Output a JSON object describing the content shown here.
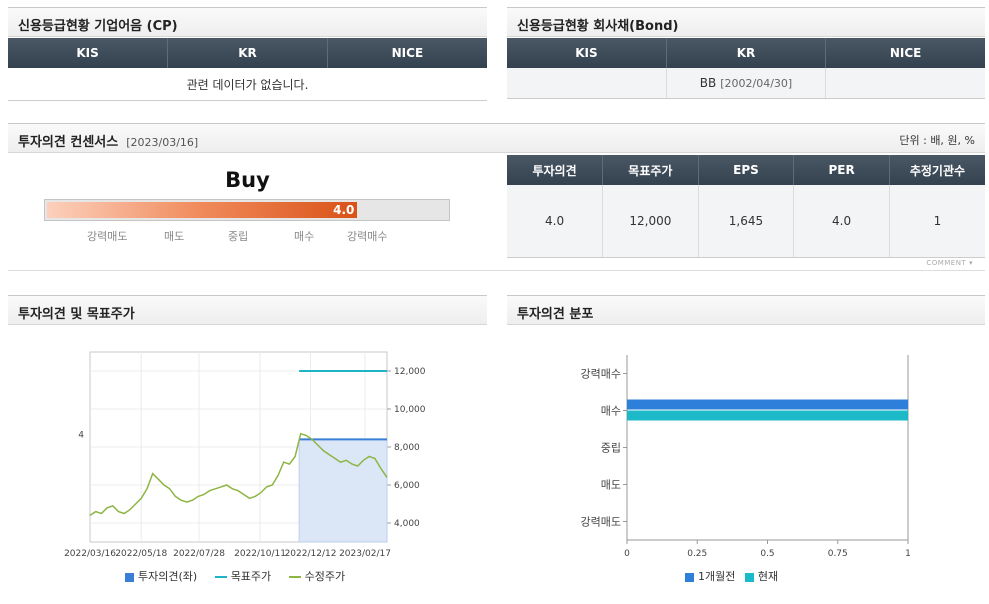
{
  "cp": {
    "title": "신용등급현황 기업어음 (CP)",
    "headers": [
      "KIS",
      "KR",
      "NICE"
    ],
    "empty_text": "관련 데이터가 없습니다."
  },
  "bond": {
    "title": "신용등급현황 회사채(Bond)",
    "headers": [
      "KIS",
      "KR",
      "NICE"
    ],
    "kis": "",
    "kr_grade": "BB",
    "kr_date": "[2002/04/30]",
    "nice": ""
  },
  "consensus": {
    "title": "투자의견 컨센서스",
    "date": "[2023/03/16]",
    "unit": "단위 : 배, 원, %",
    "opinion_word": "Buy",
    "score": 4.0,
    "score_label": "4.0",
    "scale_labels": [
      "강력매도",
      "매도",
      "중립",
      "매수",
      "강력매수"
    ],
    "headers": [
      "투자의견",
      "목표주가",
      "EPS",
      "PER",
      "추정기관수"
    ],
    "values": [
      "4.0",
      "12,000",
      "1,645",
      "4.0",
      "1"
    ],
    "comment_label": "COMMENT",
    "colors": {
      "bar_start": "#fcd0bd",
      "bar_end": "#d95218"
    }
  },
  "chart1": {
    "title": "투자의견 및 목표주가",
    "legend": [
      "투자의견(좌)",
      "목표주가",
      "수정주가"
    ],
    "colors": {
      "opinion": "#3a7fd5",
      "target": "#1fb3c8",
      "price": "#8db543",
      "fill": "#dbe7f7"
    }
  },
  "chart2": {
    "title": "투자의견 분포",
    "legend": [
      "1개월전",
      "현재"
    ],
    "colors": {
      "month_ago": "#2e7fd9",
      "now": "#1cbac9"
    }
  },
  "chart_data": [
    {
      "type": "line",
      "title": "",
      "x_ticks": [
        "2022/03/16",
        "2022/05/18",
        "2022/07/28",
        "2022/10/11",
        "2022/12/12",
        "2023/02/17"
      ],
      "y_left_ticks": [
        "4"
      ],
      "y_right_ticks": [
        "4,000",
        "6,000",
        "8,000",
        "10,000",
        "12,000"
      ],
      "y_right_range": [
        3000,
        13000
      ],
      "series": [
        {
          "name": "투자의견(좌)",
          "type": "area",
          "start": "2022/11/28",
          "end": "2023/03/16",
          "value": 4
        },
        {
          "name": "목표주가",
          "type": "line",
          "start": "2022/11/28",
          "end": "2023/03/16",
          "value": 12000
        },
        {
          "name": "수정주가",
          "type": "line",
          "points": [
            [
              "2022/03/16",
              4400
            ],
            [
              "2022/03/23",
              4600
            ],
            [
              "2022/03/30",
              4500
            ],
            [
              "2022/04/06",
              4800
            ],
            [
              "2022/04/13",
              4900
            ],
            [
              "2022/04/20",
              4600
            ],
            [
              "2022/04/27",
              4500
            ],
            [
              "2022/05/04",
              4700
            ],
            [
              "2022/05/11",
              5000
            ],
            [
              "2022/05/18",
              5300
            ],
            [
              "2022/05/25",
              5800
            ],
            [
              "2022/06/01",
              6600
            ],
            [
              "2022/06/08",
              6300
            ],
            [
              "2022/06/15",
              6000
            ],
            [
              "2022/06/22",
              5800
            ],
            [
              "2022/06/29",
              5400
            ],
            [
              "2022/07/06",
              5200
            ],
            [
              "2022/07/13",
              5100
            ],
            [
              "2022/07/20",
              5200
            ],
            [
              "2022/07/27",
              5400
            ],
            [
              "2022/08/03",
              5500
            ],
            [
              "2022/08/10",
              5700
            ],
            [
              "2022/08/17",
              5800
            ],
            [
              "2022/08/24",
              5900
            ],
            [
              "2022/08/31",
              6000
            ],
            [
              "2022/09/07",
              5800
            ],
            [
              "2022/09/14",
              5700
            ],
            [
              "2022/09/21",
              5500
            ],
            [
              "2022/09/28",
              5300
            ],
            [
              "2022/10/05",
              5400
            ],
            [
              "2022/10/12",
              5600
            ],
            [
              "2022/10/19",
              5900
            ],
            [
              "2022/10/26",
              6000
            ],
            [
              "2022/11/02",
              6500
            ],
            [
              "2022/11/09",
              7200
            ],
            [
              "2022/11/16",
              7100
            ],
            [
              "2022/11/23",
              7500
            ],
            [
              "2022/11/30",
              8700
            ],
            [
              "2022/12/07",
              8600
            ],
            [
              "2022/12/14",
              8400
            ],
            [
              "2022/12/21",
              8100
            ],
            [
              "2022/12/28",
              7800
            ],
            [
              "2023/01/04",
              7600
            ],
            [
              "2023/01/11",
              7400
            ],
            [
              "2023/01/18",
              7200
            ],
            [
              "2023/01/25",
              7300
            ],
            [
              "2023/02/01",
              7100
            ],
            [
              "2023/02/08",
              7000
            ],
            [
              "2023/02/15",
              7300
            ],
            [
              "2023/02/22",
              7500
            ],
            [
              "2023/03/01",
              7400
            ],
            [
              "2023/03/08",
              6900
            ],
            [
              "2023/03/16",
              6400
            ]
          ]
        }
      ]
    },
    {
      "type": "bar",
      "orientation": "horizontal",
      "title": "",
      "categories": [
        "강력매수",
        "매수",
        "중립",
        "매도",
        "강력매도"
      ],
      "x_ticks": [
        "0",
        "0.25",
        "0.5",
        "0.75",
        "1"
      ],
      "xlim": [
        0,
        1
      ],
      "series": [
        {
          "name": "1개월전",
          "values": [
            0,
            1,
            0,
            0,
            0
          ]
        },
        {
          "name": "현재",
          "values": [
            0,
            1,
            0,
            0,
            0
          ]
        }
      ]
    }
  ]
}
